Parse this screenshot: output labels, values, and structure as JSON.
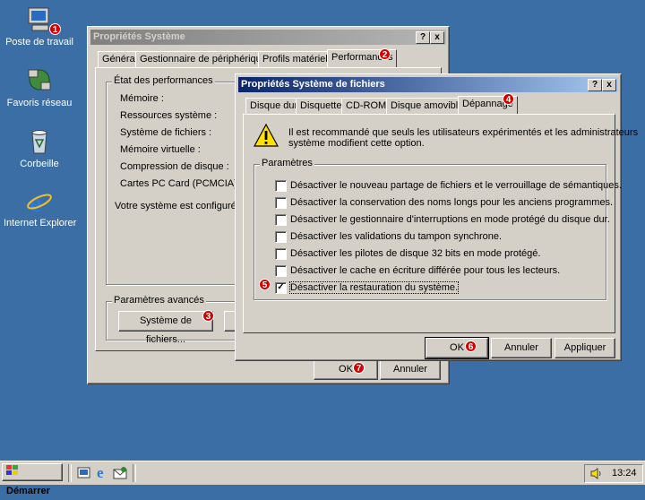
{
  "desktop": {
    "icons": [
      {
        "label": "Poste de travail",
        "icon": "my-computer-icon"
      },
      {
        "label": "Favoris réseau",
        "icon": "network-places-icon"
      },
      {
        "label": "Corbeille",
        "icon": "recycle-bin-icon"
      },
      {
        "label": "Internet Explorer",
        "icon": "internet-explorer-icon"
      }
    ]
  },
  "sys_window": {
    "title": "Propriétés Système",
    "help": "?",
    "close": "x",
    "tabs": [
      "Général",
      "Gestionnaire de périphériques",
      "Profils matériels",
      "Performances"
    ],
    "perf_group_label": "État des performances",
    "perf_rows": [
      {
        "label": "Mémoire :",
        "value": ""
      },
      {
        "label": "Ressources système :",
        "value": ""
      },
      {
        "label": "Système de fichiers :",
        "value": ""
      },
      {
        "label": "Mémoire virtuelle :",
        "value": ""
      },
      {
        "label": "Compression de disque :",
        "value": ""
      },
      {
        "label": "Cartes PC Card (PCMCIA) :",
        "value": ""
      }
    ],
    "config_text": "Votre système est configuré pou",
    "advanced_label": "Paramètres avancés",
    "fs_button": "Système de fichiers...",
    "ok": "OK",
    "cancel": "Annuler"
  },
  "fs_dialog": {
    "title": "Propriétés Système de fichiers",
    "help": "?",
    "close": "x",
    "tabs": [
      "Disque dur",
      "Disquette",
      "CD-ROM",
      "Disque amovible",
      "Dépannage"
    ],
    "warning_line1": "Il est recommandé que seuls les utilisateurs expérimentés et les administrateurs",
    "warning_line2": "système modifient cette option.",
    "params_label": "Paramètres",
    "options": [
      {
        "label": "Désactiver le nouveau partage de fichiers et le verrouillage de sémantiques.",
        "checked": false
      },
      {
        "label": "Désactiver la conservation des noms longs pour les anciens programmes.",
        "checked": false
      },
      {
        "label": "Désactiver le gestionnaire d'interruptions en mode protégé du disque dur.",
        "checked": false
      },
      {
        "label": "Désactiver les validations du tampon synchrone.",
        "checked": false
      },
      {
        "label": "Désactiver les pilotes de disque 32 bits en mode protégé.",
        "checked": false
      },
      {
        "label": "Désactiver le cache en écriture différée pour tous les lecteurs.",
        "checked": false
      },
      {
        "label": "Désactiver la restauration du système.",
        "checked": true
      }
    ],
    "check_mark": "✓",
    "ok": "OK",
    "cancel": "Annuler",
    "apply": "Appliquer"
  },
  "badges": [
    "1",
    "2",
    "3",
    "4",
    "5",
    "6",
    "7"
  ],
  "taskbar": {
    "start": "Démarrer",
    "clock": "13:24",
    "quick_launch": [
      "show-desktop-icon",
      "internet-explorer-icon",
      "outlook-express-icon"
    ]
  }
}
